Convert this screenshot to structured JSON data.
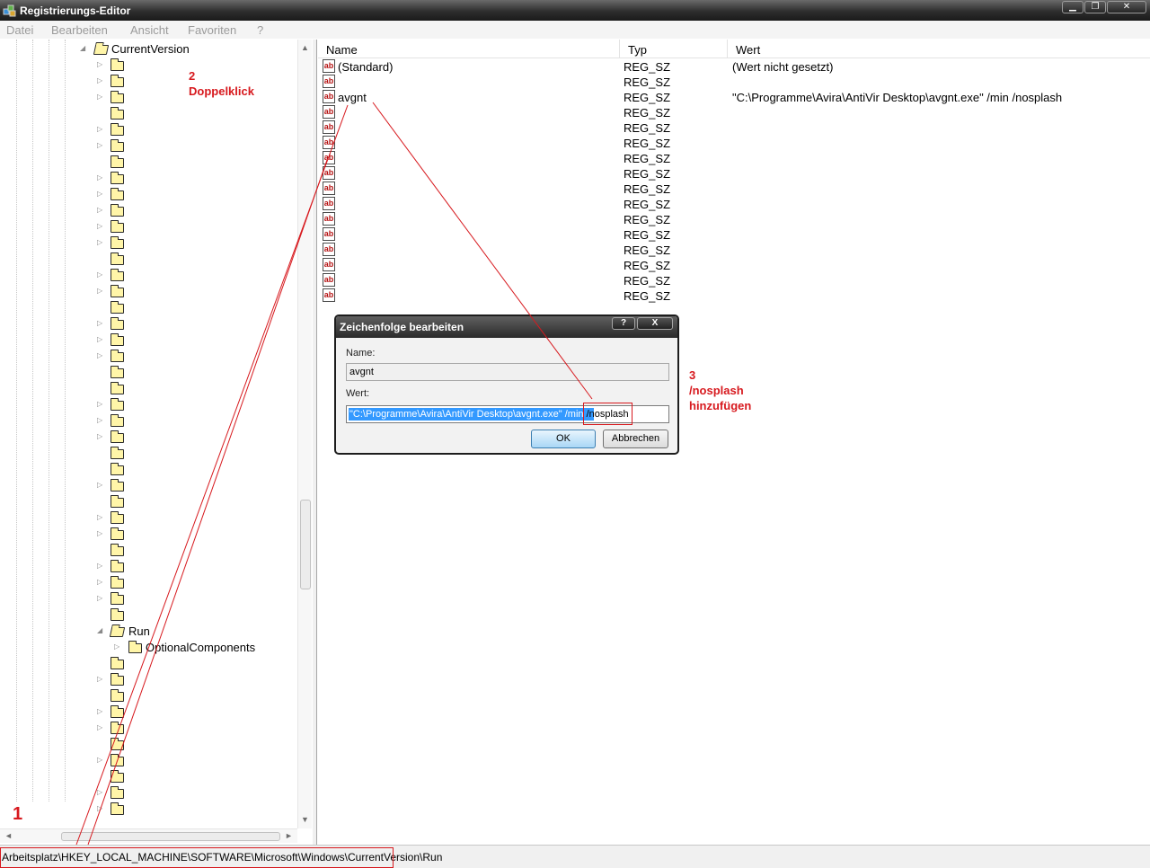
{
  "window": {
    "title": "Registrierungs-Editor",
    "controls": {
      "minimize": "▁",
      "maximize": "❐",
      "close": "✕"
    }
  },
  "menu": [
    "Datei",
    "Bearbeiten",
    "Ansicht",
    "Favoriten",
    "?"
  ],
  "tree": {
    "current_version": "CurrentVersion",
    "run": "Run",
    "optional_components": "OptionalComponents"
  },
  "list": {
    "columns": {
      "name": "Name",
      "type": "Typ",
      "value": "Wert"
    },
    "rows": [
      {
        "name": "(Standard)",
        "type": "REG_SZ",
        "value": "(Wert nicht gesetzt)"
      },
      {
        "name": "",
        "type": "REG_SZ",
        "value": ""
      },
      {
        "name": "avgnt",
        "type": "REG_SZ",
        "value": "\"C:\\Programme\\Avira\\AntiVir Desktop\\avgnt.exe\" /min /nosplash"
      },
      {
        "name": "",
        "type": "REG_SZ",
        "value": ""
      },
      {
        "name": "",
        "type": "REG_SZ",
        "value": ""
      },
      {
        "name": "",
        "type": "REG_SZ",
        "value": ""
      },
      {
        "name": "",
        "type": "REG_SZ",
        "value": ""
      },
      {
        "name": "",
        "type": "REG_SZ",
        "value": ""
      },
      {
        "name": "",
        "type": "REG_SZ",
        "value": ""
      },
      {
        "name": "",
        "type": "REG_SZ",
        "value": ""
      },
      {
        "name": "",
        "type": "REG_SZ",
        "value": ""
      },
      {
        "name": "",
        "type": "REG_SZ",
        "value": ""
      },
      {
        "name": "",
        "type": "REG_SZ",
        "value": ""
      },
      {
        "name": "",
        "type": "REG_SZ",
        "value": ""
      },
      {
        "name": "",
        "type": "REG_SZ",
        "value": ""
      },
      {
        "name": "",
        "type": "REG_SZ",
        "value": ""
      }
    ],
    "icon_glyph": "ab"
  },
  "dialog": {
    "title": "Zeichenfolge bearbeiten",
    "help_label": "?",
    "close_label": "X",
    "name_label": "Name:",
    "name_value": "avgnt",
    "value_label": "Wert:",
    "value_selected": "\"C:\\Programme\\Avira\\AntiVir Desktop\\avgnt.exe\" /min",
    "value_added": " /nosplash",
    "ok_label": "OK",
    "cancel_label": "Abbrechen"
  },
  "status": {
    "path": "Arbeitsplatz\\HKEY_LOCAL_MACHINE\\SOFTWARE\\Microsoft\\Windows\\CurrentVersion\\Run"
  },
  "annotations": {
    "step1": "1",
    "step2_number": "2",
    "step2_text": "Doppelklick",
    "step3_number": "3",
    "step3_line1": "/nosplash",
    "step3_line2": "hinzufügen",
    "color": "#d7191e"
  },
  "scroll": {
    "up": "▲",
    "down": "▼",
    "left": "◄",
    "right": "►"
  },
  "tree_glyphs": {
    "collapsed": "▷",
    "expanded": "◢"
  }
}
